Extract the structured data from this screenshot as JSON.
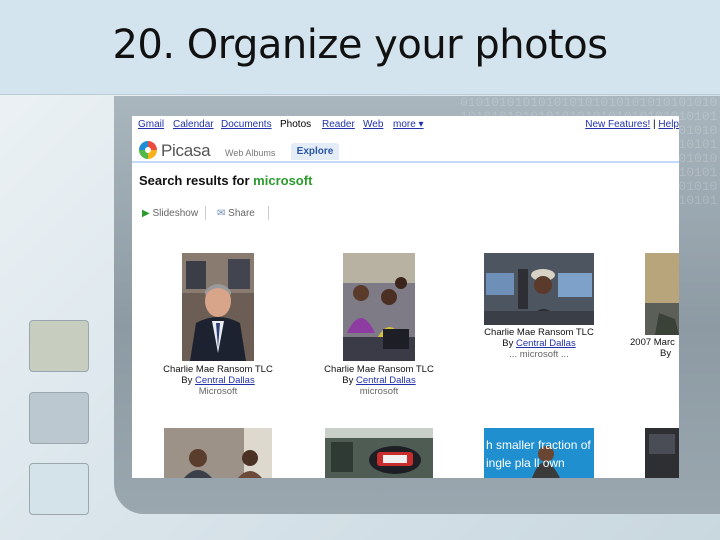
{
  "slide": {
    "title": "20. Organize your photos",
    "binary_decoration": "0101010101010101010101010101010101010101010101010101010101010101010101010101010101010101010101010101010101010101010101010101010101010101010101010101010101010101010101010101010101010101010101010101010101010101010101010101010101010101010101010101010101010101010101010101010101010101010101"
  },
  "google_bar": {
    "links": [
      "Gmail",
      "Calendar",
      "Documents",
      "Photos",
      "Reader",
      "Web",
      "more ▾"
    ],
    "current": "Photos",
    "right_new": "New Features!",
    "right_sep": "|",
    "right_help": "Help"
  },
  "picasa": {
    "logo_text": "Picasa",
    "logo_sub": "Web Albums",
    "tab_explore": "Explore"
  },
  "search": {
    "prefix": "Search results for",
    "term": "microsoft"
  },
  "actions": {
    "slideshow": "Slideshow",
    "share": "Share"
  },
  "results": [
    {
      "title": "Charlie Mae Ransom TLC",
      "by": "By",
      "author": "Central Dallas",
      "tag": "Microsoft"
    },
    {
      "title": "Charlie Mae Ransom TLC",
      "by": "By",
      "author": "Central Dallas",
      "tag": "microsoft"
    },
    {
      "title": "Charlie Mae Ransom TLC",
      "by": "By",
      "author": "Central Dallas",
      "tag": "... microsoft ..."
    },
    {
      "title": "2007 Marc",
      "by": "By",
      "author": "",
      "tag": ""
    }
  ],
  "bottom_row": {
    "photo3_text_line1": "h smaller fraction of",
    "photo3_text_line2": "ingle pla     ll own"
  },
  "colors": {
    "link_blue": "#2233aa",
    "term_green": "#2c9a2c",
    "title_bar": "#d3e4ee"
  }
}
